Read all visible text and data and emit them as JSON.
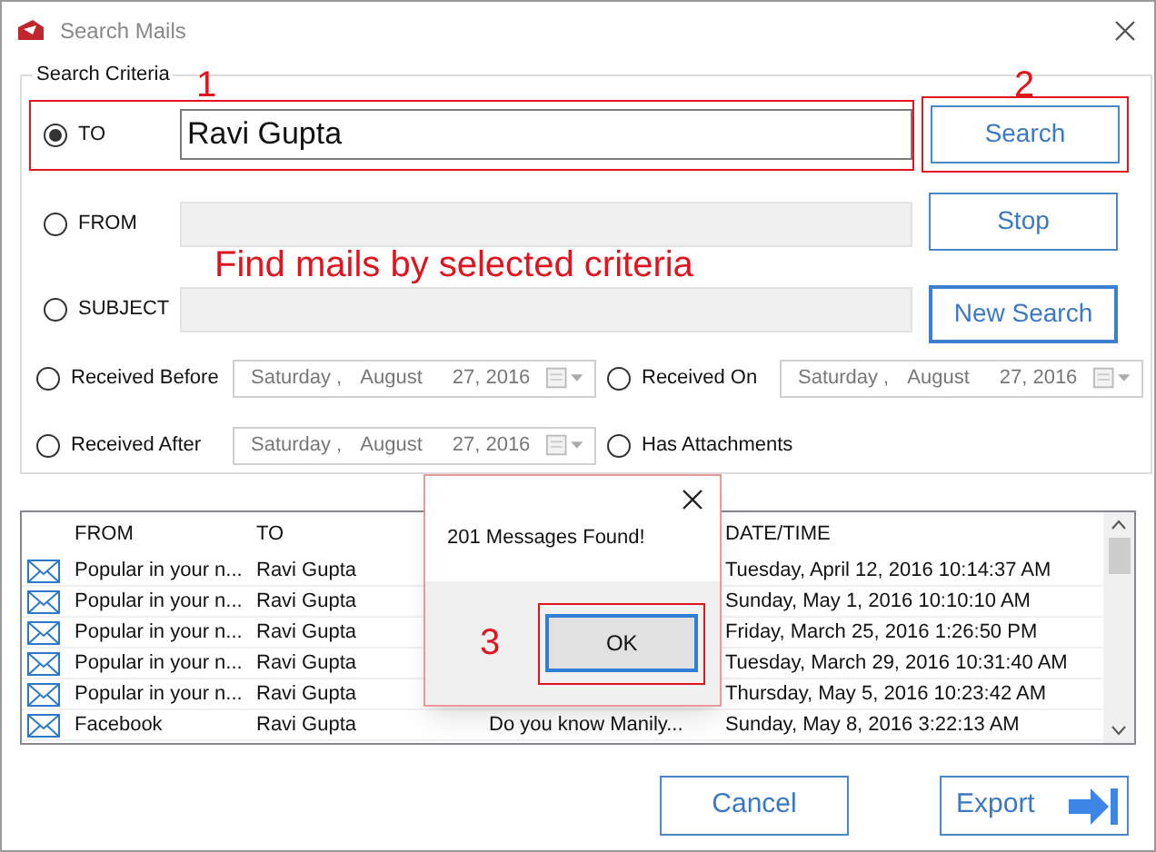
{
  "window": {
    "title": "Search Mails"
  },
  "criteria": {
    "title": "Search Criteria",
    "marker": "1",
    "fields": [
      {
        "label": "TO",
        "selected": true,
        "value": "Ravi Gupta"
      },
      {
        "label": "FROM",
        "selected": false
      },
      {
        "label": "SUBJECT",
        "selected": false
      }
    ],
    "caption": "Find mails by selected criteria",
    "dates": [
      {
        "label": "Received Before",
        "selected": false,
        "day": "Saturday",
        "separator": ",",
        "month": "August",
        "date": "27, 2016"
      },
      {
        "label": "Received On",
        "selected": false,
        "day": "Saturday",
        "separator": ",",
        "month": "August",
        "date": "27, 2016"
      },
      {
        "label": "Received After",
        "selected": false,
        "day": "Saturday",
        "separator": ",",
        "month": "August",
        "date": "27, 2016"
      }
    ],
    "attachments": {
      "label": "Has Attachments",
      "selected": false
    }
  },
  "actions": {
    "marker": "2",
    "buttons": [
      "Search",
      "Stop",
      "New Search"
    ]
  },
  "table": {
    "columns": [
      "FROM",
      "TO",
      "DATE/TIME"
    ],
    "rows": [
      {
        "from": "Popular in your n...",
        "to": "Ravi Gupta",
        "date": "Tuesday, April 12, 2016 10:14:37 AM"
      },
      {
        "from": "Popular in your n...",
        "to": "Ravi Gupta",
        "date": "Sunday, May 1, 2016 10:10:10 AM"
      },
      {
        "from": "Popular in your n...",
        "to": "Ravi Gupta",
        "date": "Friday, March 25, 2016 1:26:50 PM"
      },
      {
        "from": "Popular in your n...",
        "to": "Ravi Gupta",
        "date": "Tuesday, March 29, 2016 10:31:40 AM"
      },
      {
        "from": "Popular in your n...",
        "to": "Ravi Gupta",
        "date": "Thursday, May 5, 2016 10:23:42 AM"
      },
      {
        "from": "Facebook",
        "to": "Ravi Gupta",
        "subject": "Do you know Manily...",
        "date": "Sunday, May 8, 2016 3:22:13 AM"
      }
    ]
  },
  "dialog": {
    "message": "201 Messages Found!",
    "button": "OK",
    "marker": "3"
  },
  "footer_buttons": [
    "Cancel",
    "Export"
  ]
}
